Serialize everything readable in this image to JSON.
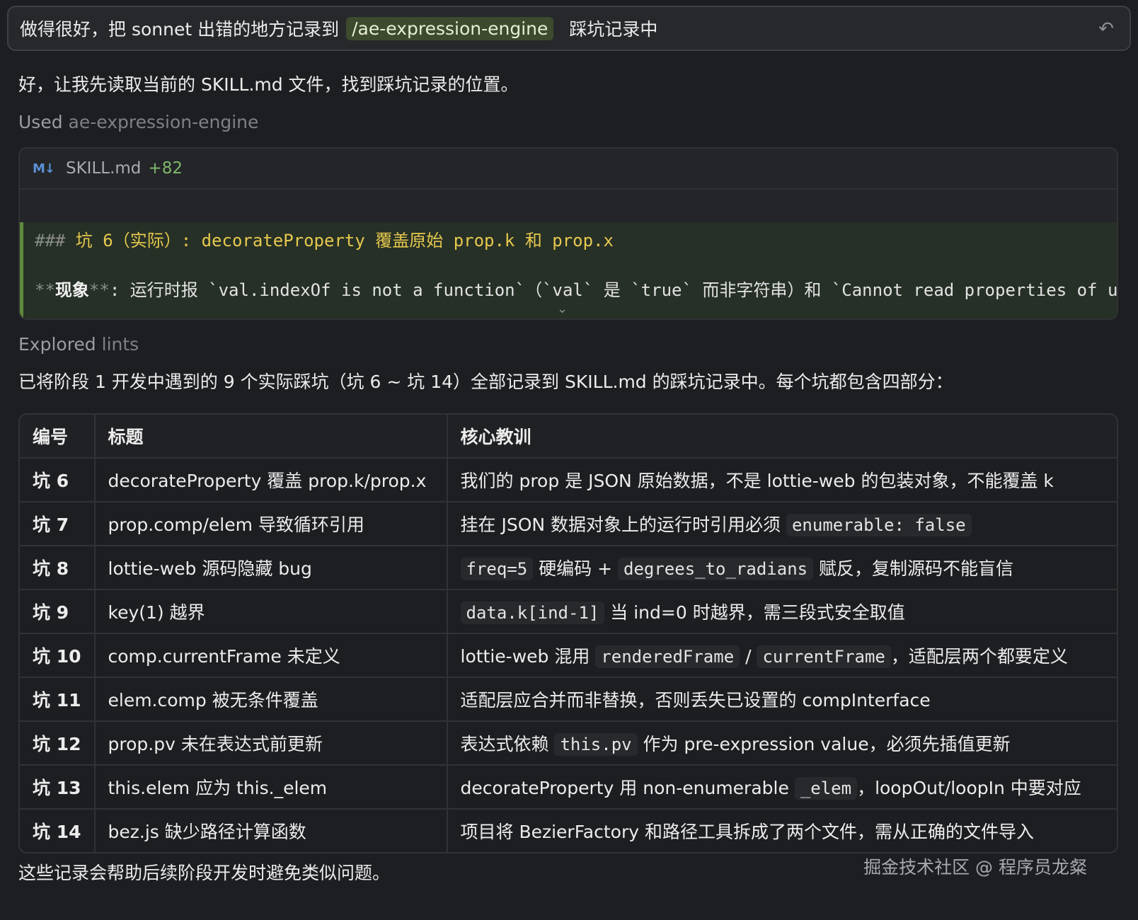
{
  "prompt": {
    "pre": "做得很好，把 sonnet 出错的地方记录到",
    "chip": "/ae-expression-engine",
    "post": "踩坑记录中",
    "undo_icon": "undo-icon"
  },
  "response": {
    "intro": "好，让我先读取当前的 SKILL.md 文件，找到踩坑记录的位置。",
    "used_label": "Used",
    "used_tool": "ae-expression-engine",
    "card": {
      "icon": "M↓",
      "file": "SKILL.md",
      "added": "+82",
      "line1_hash": "###",
      "line1_text": " 坑 6（实际）: decorateProperty 覆盖原始 prop.k 和 prop.x",
      "line2_pre": "**",
      "line2_bold": "现象",
      "line2_post": "**",
      "line2_rest": ": 运行时报 `val.indexOf is not a function`（`val` 是 `true` 而非字符串）和 `Cannot read properties of ur"
    },
    "explored_label": "Explored",
    "explored_target": "lints",
    "summary": "已将阶段 1 开发中遇到的 9 个实际踩坑（坑 6 ~ 坑 14）全部记录到 SKILL.md 的踩坑记录中。每个坑都包含四部分：",
    "table": {
      "headers": [
        "编号",
        "标题",
        "核心教训"
      ],
      "rows": [
        {
          "id": "坑 6",
          "title": "decorateProperty 覆盖 prop.k/prop.x",
          "lesson": [
            "我们的 prop 是 JSON 原始数据，不是 lottie-web 的包装对象，不能覆盖 k"
          ]
        },
        {
          "id": "坑 7",
          "title": "prop.comp/elem 导致循环引用",
          "lesson": [
            "挂在 JSON 数据对象上的运行时引用必须 ",
            {
              "code": "enumerable: false"
            }
          ]
        },
        {
          "id": "坑 8",
          "title": "lottie-web 源码隐藏 bug",
          "lesson": [
            {
              "code": "freq=5"
            },
            " 硬编码 + ",
            {
              "code": "degrees_to_radians"
            },
            " 赋反，复制源码不能盲信"
          ]
        },
        {
          "id": "坑 9",
          "title": "key(1) 越界",
          "lesson": [
            {
              "code": "data.k[ind-1]"
            },
            " 当 ind=0 时越界，需三段式安全取值"
          ]
        },
        {
          "id": "坑 10",
          "title": "comp.currentFrame 未定义",
          "lesson": [
            "lottie-web 混用 ",
            {
              "code": "renderedFrame"
            },
            " / ",
            {
              "code": "currentFrame"
            },
            "，适配层两个都要定义"
          ]
        },
        {
          "id": "坑 11",
          "title": "elem.comp 被无条件覆盖",
          "lesson": [
            "适配层应合并而非替换，否则丢失已设置的 compInterface"
          ]
        },
        {
          "id": "坑 12",
          "title": "prop.pv 未在表达式前更新",
          "lesson": [
            "表达式依赖 ",
            {
              "code": "this.pv"
            },
            " 作为 pre-expression value，必须先插值更新"
          ]
        },
        {
          "id": "坑 13",
          "title": "this.elem 应为 this._elem",
          "lesson": [
            "decorateProperty 用 non-enumerable ",
            {
              "code": "_elem"
            },
            "，loopOut/loopIn 中要对应"
          ]
        },
        {
          "id": "坑 14",
          "title": "bez.js 缺少路径计算函数",
          "lesson": [
            "项目将 BezierFactory 和路径工具拆成了两个文件，需从正确的文件导入"
          ]
        }
      ]
    },
    "footer": "这些记录会帮助后续阶段开发时避免类似问题。"
  },
  "watermark": "掘金技术社区 @ 程序员龙粲"
}
